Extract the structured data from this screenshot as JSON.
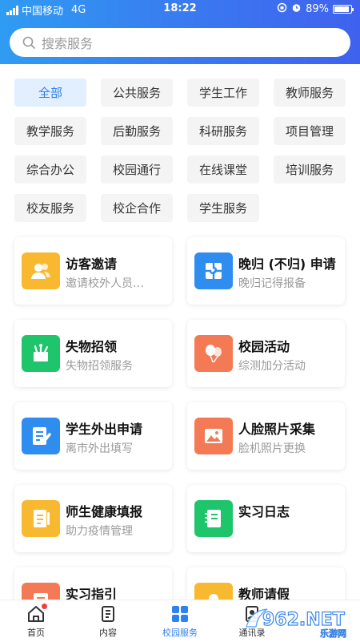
{
  "status_bar": {
    "carrier": "中国移动",
    "network": "4G",
    "time": "18:22",
    "battery": "89%"
  },
  "search": {
    "placeholder": "搜索服务"
  },
  "categories": [
    "全部",
    "公共服务",
    "学生工作",
    "教师服务",
    "教学服务",
    "后勤服务",
    "科研服务",
    "项目管理",
    "综合办公",
    "校园通行",
    "在线课堂",
    "培训服务",
    "校友服务",
    "校企合作",
    "学生服务"
  ],
  "active_category": "全部",
  "services": [
    {
      "title": "访客邀请",
      "subtitle": "邀请校外人员…",
      "color": "#f8b930",
      "icon": "user-group-icon"
    },
    {
      "title": "晚归 (不归) 申请",
      "subtitle": "晚归记得报备",
      "color": "#2f8df0",
      "icon": "puzzle-icon"
    },
    {
      "title": "失物招领",
      "subtitle": "失物招领服务",
      "color": "#1fc56b",
      "icon": "lost-found-icon"
    },
    {
      "title": "校园活动",
      "subtitle": "综测加分活动",
      "color": "#f47a55",
      "icon": "balloon-icon"
    },
    {
      "title": "学生外出申请",
      "subtitle": "离市外出填写",
      "color": "#2f8df0",
      "icon": "edit-form-icon"
    },
    {
      "title": "人脸照片采集",
      "subtitle": "脸机照片更换",
      "color": "#f47a55",
      "icon": "image-icon"
    },
    {
      "title": "师生健康填报",
      "subtitle": "助力疫情管理",
      "color": "#f8b930",
      "icon": "health-form-icon"
    },
    {
      "title": "实习日志",
      "subtitle": "",
      "color": "#1fc56b",
      "icon": "notebook-icon"
    },
    {
      "title": "实习指引",
      "subtitle": "",
      "color": "#f47a55",
      "icon": "guide-icon"
    },
    {
      "title": "教师请假",
      "subtitle": "",
      "color": "#f8b930",
      "icon": "leave-icon"
    }
  ],
  "tabbar": [
    {
      "label": "首页",
      "icon": "home-icon",
      "badge": true
    },
    {
      "label": "内容",
      "icon": "document-icon"
    },
    {
      "label": "校园服务",
      "icon": "grid-icon",
      "active": true
    },
    {
      "label": "通讯录",
      "icon": "contacts-icon"
    }
  ],
  "watermark": {
    "text": "962.NET",
    "sub": "乐游网"
  },
  "colors": {
    "accent": "#2f80f0",
    "header_start": "#2f9cf2",
    "header_end": "#3f62ee"
  }
}
